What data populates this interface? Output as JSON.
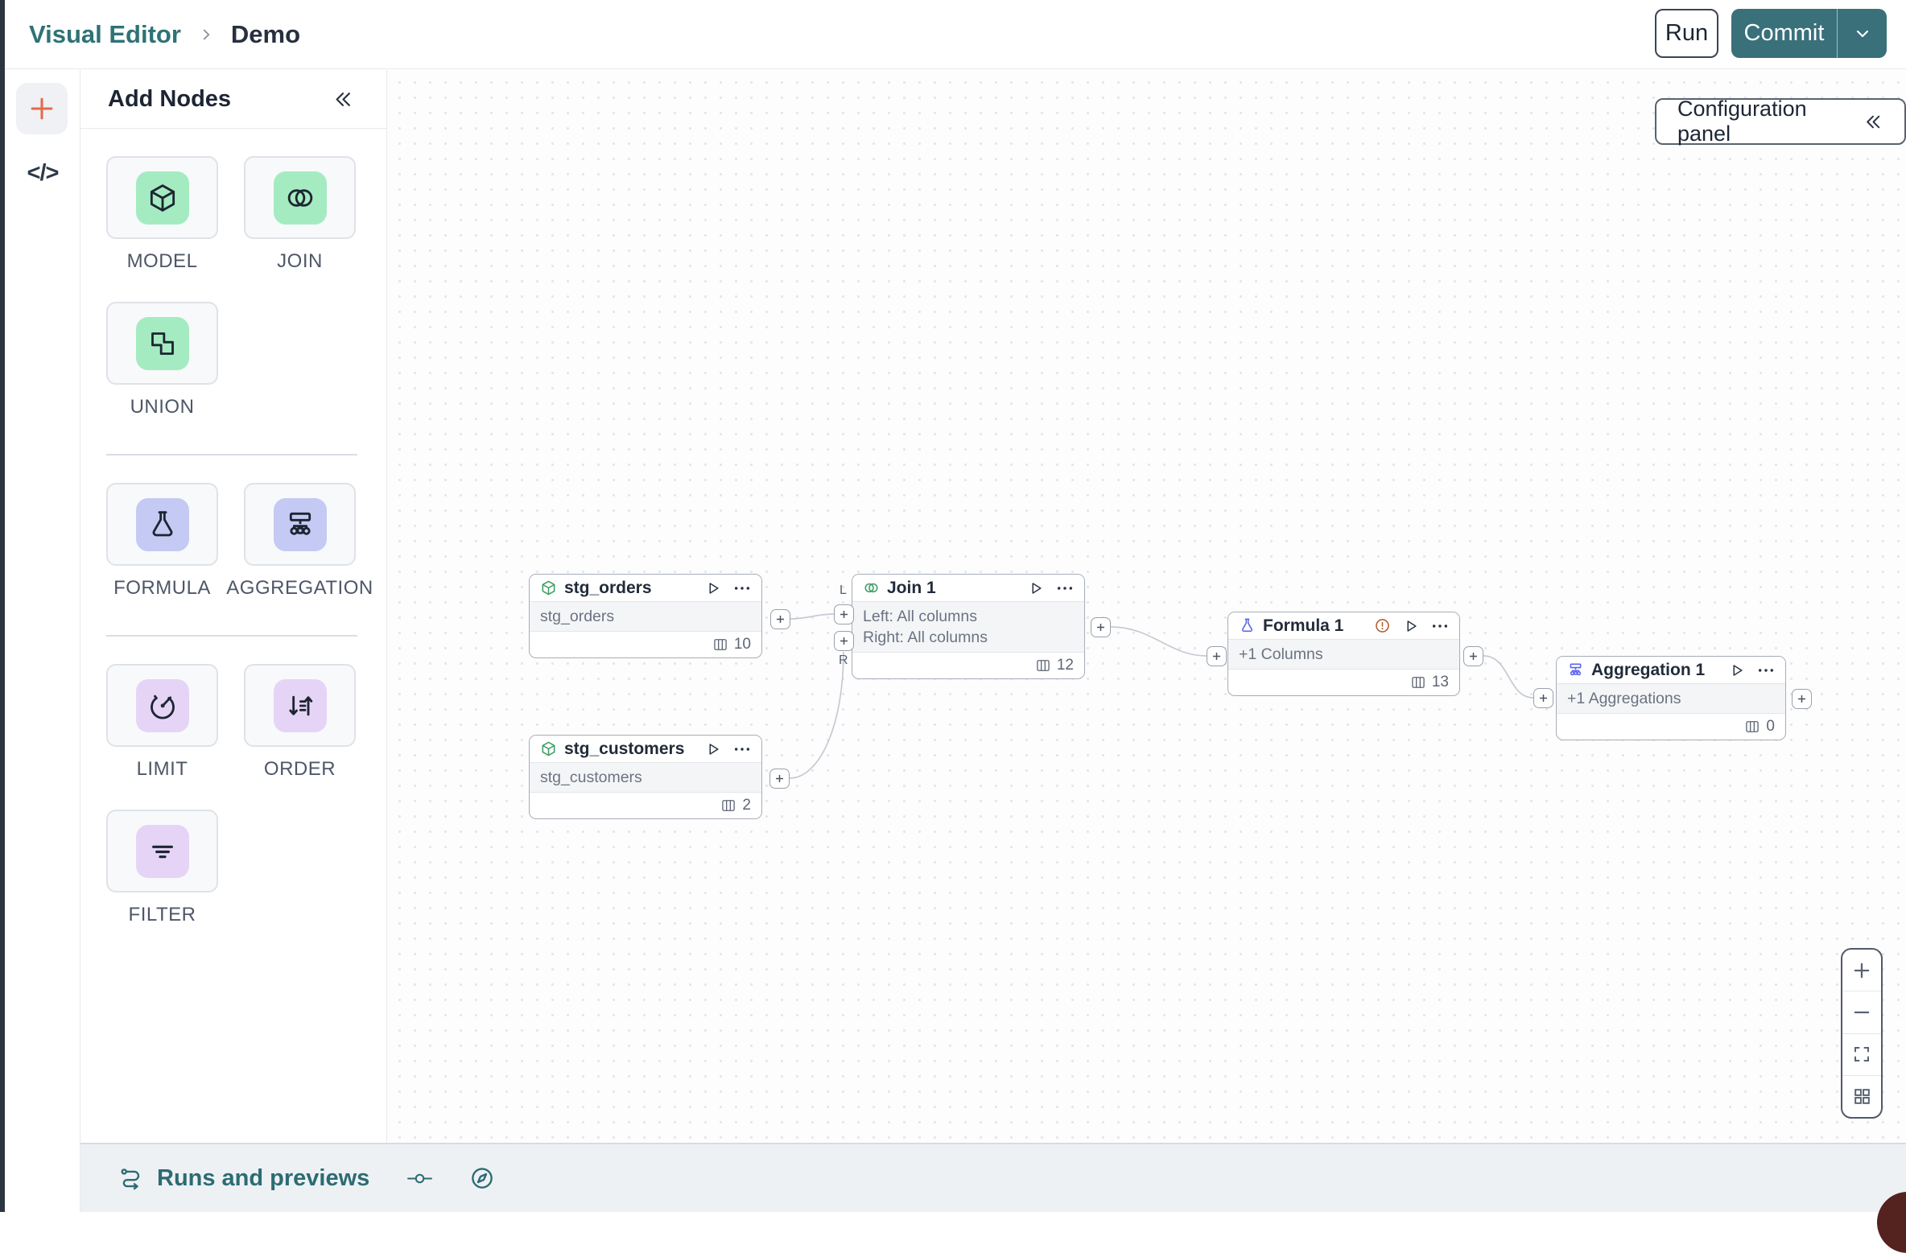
{
  "colors": {
    "accent_teal": "#39707a",
    "breadcrumb_teal": "#2e7277",
    "tint_green": "#a4ebc1",
    "tint_periwinkle": "#c4caf3",
    "tint_purple": "#e6d4f7",
    "rail_plus_orange": "#e4694b",
    "node_icon_green": "#3f9e66",
    "node_icon_indigo": "#5d63ee",
    "warning_orange": "#b15f31"
  },
  "topbar": {
    "breadcrumb_app": "Visual Editor",
    "breadcrumb_page": "Demo",
    "run_label": "Run",
    "commit_label": "Commit"
  },
  "left_rail": {
    "add_icon": "plus-icon",
    "code_glyph": "</>"
  },
  "panel": {
    "title": "Add Nodes",
    "collapse_icon": "chevrons-left-icon",
    "sections": [
      {
        "items": [
          {
            "label": "MODEL",
            "icon": "cube-icon"
          },
          {
            "label": "JOIN",
            "icon": "venn-icon"
          },
          {
            "label": "UNION",
            "icon": "union-icon"
          }
        ]
      },
      {
        "items": [
          {
            "label": "FORMULA",
            "icon": "flask-icon"
          },
          {
            "label": "AGGREGATION",
            "icon": "sitemap-icon"
          }
        ]
      },
      {
        "items": [
          {
            "label": "LIMIT",
            "icon": "gauge-icon"
          },
          {
            "label": "ORDER",
            "icon": "sort-icon"
          },
          {
            "label": "FILTER",
            "icon": "filter-lines-icon"
          }
        ]
      }
    ]
  },
  "canvas": {
    "config_button_label": "Configuration panel",
    "port_labels": {
      "left": "L",
      "right": "R"
    },
    "nodes": [
      {
        "title": "stg_orders",
        "icon": "cube-icon",
        "body_lines": [
          "stg_orders"
        ],
        "columns": "10"
      },
      {
        "title": "stg_customers",
        "icon": "cube-icon",
        "body_lines": [
          "stg_customers"
        ],
        "columns": "2"
      },
      {
        "title": "Join 1",
        "icon": "venn-icon",
        "body_lines": [
          "Left: All columns",
          "Right: All columns"
        ],
        "columns": "12"
      },
      {
        "title": "Formula 1",
        "icon": "flask-icon",
        "body_lines": [
          "+1 Columns"
        ],
        "columns": "13",
        "warning": true
      },
      {
        "title": "Aggregation 1",
        "icon": "sitemap-icon",
        "body_lines": [
          "+1 Aggregations"
        ],
        "columns": "0"
      }
    ]
  },
  "bottom_bar": {
    "runs_label": "Runs and previews",
    "icons": [
      "route-icon",
      "commit-node-icon",
      "compass-icon"
    ]
  }
}
